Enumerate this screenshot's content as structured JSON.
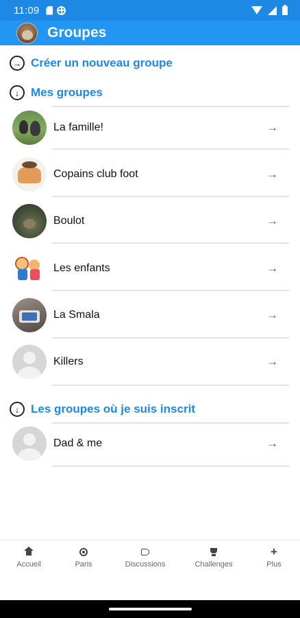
{
  "status_bar": {
    "time": "11:09"
  },
  "app_bar": {
    "title": "Groupes"
  },
  "actions": {
    "create_group": {
      "label": "Créer un nouveau groupe",
      "icon": "arrow-right-circle-icon"
    }
  },
  "my_groups": {
    "heading": "Mes groupes",
    "items": [
      {
        "name": "La famille!",
        "avatar": "photo-birds"
      },
      {
        "name": "Copains club foot",
        "avatar": "illustration-players"
      },
      {
        "name": "Boulot",
        "avatar": "photo-animal"
      },
      {
        "name": "Les enfants",
        "avatar": "illustration-kids"
      },
      {
        "name": "La Smala",
        "avatar": "photo-screen"
      },
      {
        "name": "Killers",
        "avatar": "default-avatar"
      }
    ]
  },
  "subscribed_groups": {
    "heading": "Les groupes où je suis inscrit",
    "items": [
      {
        "name": "Dad & me",
        "avatar": "default-avatar"
      }
    ]
  },
  "row_arrow": "→",
  "bottom_nav": {
    "items": [
      {
        "label": "Accueil",
        "icon": "home-icon"
      },
      {
        "label": "Paris",
        "icon": "football-icon"
      },
      {
        "label": "Discussions",
        "icon": "chat-icon"
      },
      {
        "label": "Challenges",
        "icon": "trophy-icon"
      },
      {
        "label": "Plus",
        "icon": "plus-icon",
        "glyph": "+"
      }
    ]
  },
  "colors": {
    "primary": "#2196f3",
    "status_bar": "#1e88e5",
    "link": "#1e88e5"
  }
}
